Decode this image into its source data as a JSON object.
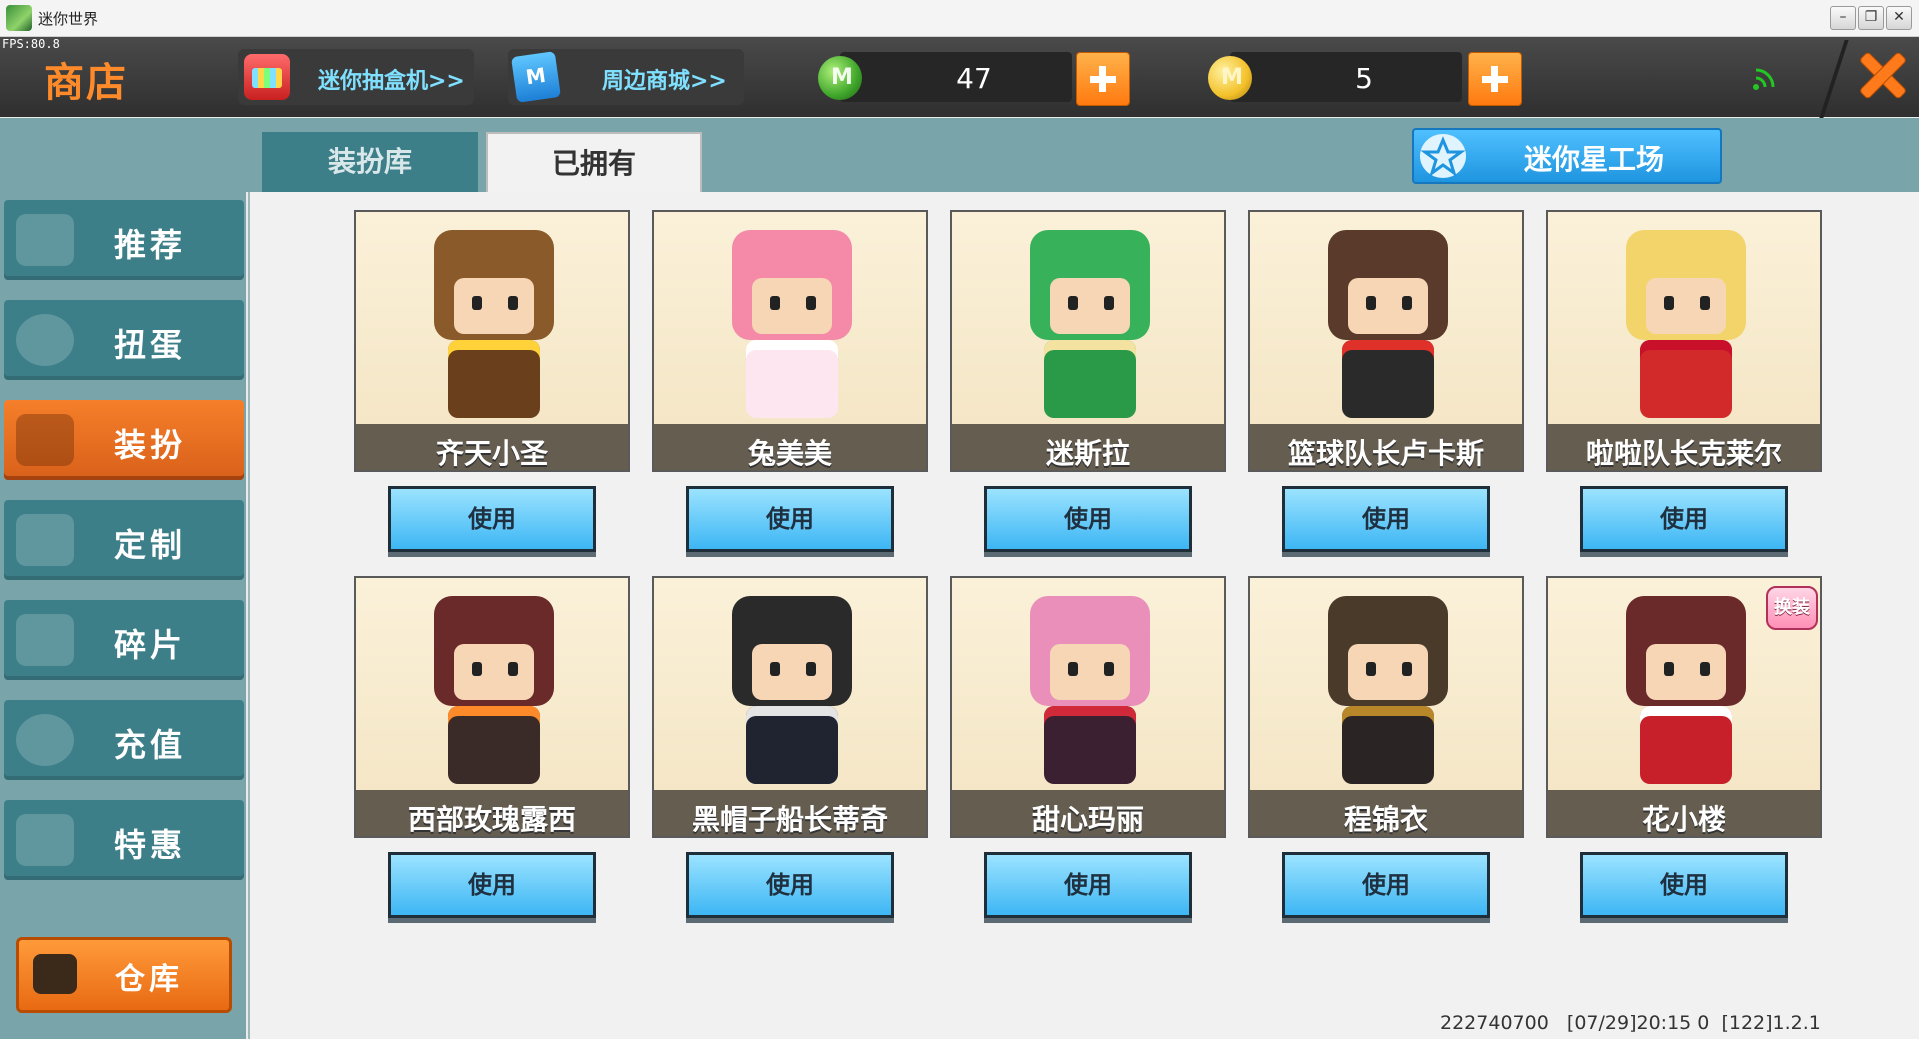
{
  "window": {
    "title": "迷你世界",
    "fps": "FPS:80.8"
  },
  "header": {
    "title": "商店",
    "gachabox_label": "迷你抽盒机>>",
    "mall_label": "周边商城>>",
    "gem_amount": "47",
    "coin_amount": "5"
  },
  "sidebar": {
    "items": [
      {
        "label": "推荐",
        "icon": "thumbs-up-icon"
      },
      {
        "label": "扭蛋",
        "icon": "capsule-icon"
      },
      {
        "label": "装扮",
        "icon": "shirt-icon",
        "active": true
      },
      {
        "label": "定制",
        "icon": "pencil-icon"
      },
      {
        "label": "碎片",
        "icon": "puzzle-icon"
      },
      {
        "label": "充值",
        "icon": "coins-icon"
      },
      {
        "label": "特惠",
        "icon": "gift-icon"
      }
    ],
    "warehouse_label": "仓库"
  },
  "tabs": {
    "dress_library": "装扮库",
    "owned": "已拥有"
  },
  "workshop_label": "迷你星工场",
  "skins": [
    {
      "name": "齐天小圣",
      "action": "使用",
      "head": "#8a5a2a",
      "body": "#6a3f1c",
      "accent": "#ffd23a"
    },
    {
      "name": "兔美美",
      "action": "使用",
      "head": "#f58aa8",
      "body": "#fde6ef",
      "accent": "#ffffff"
    },
    {
      "name": "迷斯拉",
      "action": "使用",
      "head": "#37b25a",
      "body": "#2a9a49",
      "accent": "#f4e3a0"
    },
    {
      "name": "篮球队长卢卡斯",
      "action": "使用",
      "head": "#5a3a2a",
      "body": "#2a2a2a",
      "accent": "#e0302a"
    },
    {
      "name": "啦啦队长克莱尔",
      "action": "使用",
      "head": "#f3d46b",
      "body": "#d22a2a",
      "accent": "#c9102a"
    },
    {
      "name": "西部玫瑰露西",
      "action": "使用",
      "head": "#6a2a2a",
      "body": "#3a2a28",
      "accent": "#ff8a2a"
    },
    {
      "name": "黑帽子船长蒂奇",
      "action": "使用",
      "head": "#2a2a2a",
      "body": "#1f2430",
      "accent": "#e4e4e4"
    },
    {
      "name": "甜心玛丽",
      "action": "使用",
      "head": "#e98fb9",
      "body": "#3a2030",
      "accent": "#d02a3a"
    },
    {
      "name": "程锦衣",
      "action": "使用",
      "head": "#4a3a2a",
      "body": "#2a2424",
      "accent": "#b8872a"
    },
    {
      "name": "花小楼",
      "action": "使用",
      "head": "#6a2a2a",
      "body": "#c8202a",
      "accent": "#ffffff",
      "badge": "换装"
    }
  ],
  "footer": {
    "id": "222740700",
    "build": "[07/29]20:15 0  [122]1.2.1"
  },
  "colors": {
    "accent_orange": "#ff8a2a",
    "sidebar_teal": "#3d7f89",
    "button_blue": "#3db6f4"
  }
}
